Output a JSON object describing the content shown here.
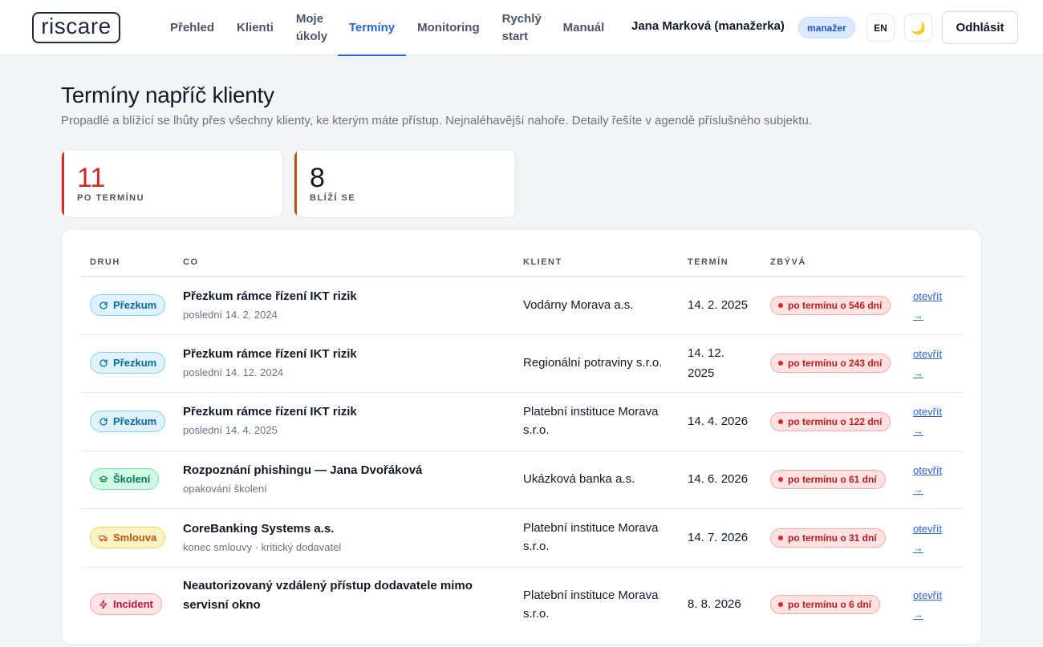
{
  "app": {
    "logo_text": "riscare"
  },
  "nav": {
    "items": [
      {
        "label": "Přehled"
      },
      {
        "label": "Klienti"
      },
      {
        "label": "Moje úkoly"
      },
      {
        "label": "Termíny"
      },
      {
        "label": "Monitoring"
      },
      {
        "label": "Rychlý start"
      },
      {
        "label": "Manuál"
      }
    ],
    "active": "Termíny"
  },
  "user": {
    "name": "Jana Marková (manažerka)",
    "role": "manažer",
    "lang_label": "EN",
    "theme_icon": "🌙",
    "logout_label": "Odhlásit"
  },
  "page": {
    "title": "Termíny napříč klienty",
    "subtitle": "Propadlé a blížící se lhůty přes všechny klienty, ke kterým máte přístup. Nejnaléhavější nahoře. Detaily řešíte v agendě příslušného subjektu."
  },
  "stats": [
    {
      "value": "11",
      "label": "PO TERMÍNU",
      "color": "#dc2626"
    },
    {
      "value": "8",
      "label": "BLÍŽÍ SE",
      "color": "#b45309"
    }
  ],
  "table": {
    "columns": [
      "DRUH",
      "CO",
      "KLIENT",
      "TERMÍN",
      "ZBÝVÁ"
    ],
    "rows": [
      {
        "type": "Přezkum",
        "kind": "review",
        "title": "Přezkum rámce řízení IKT rizik",
        "sub": "poslední 14. 2. 2024",
        "client": "Vodárny Morava a.s.",
        "date": "14. 2. 2025",
        "remaining": "po termínu o 546 dní",
        "link": "otevřít →"
      },
      {
        "type": "Přezkum",
        "kind": "review",
        "title": "Přezkum rámce řízení IKT rizik",
        "sub": "poslední 14. 12. 2024",
        "client": "Regionální potraviny s.r.o.",
        "date": "14. 12. 2025",
        "remaining": "po termínu o 243 dní",
        "link": "otevřít →"
      },
      {
        "type": "Přezkum",
        "kind": "review",
        "title": "Přezkum rámce řízení IKT rizik",
        "sub": "poslední 14. 4. 2025",
        "client": "Platební instituce Morava s.r.o.",
        "date": "14. 4. 2026",
        "remaining": "po termínu o 122 dní",
        "link": "otevřít →"
      },
      {
        "type": "Školení",
        "kind": "training",
        "title": "Rozpoznání phishingu — Jana Dvořáková",
        "sub": "opakování školení",
        "client": "Ukázková banka a.s.",
        "date": "14. 6. 2026",
        "remaining": "po termínu o 61 dní",
        "link": "otevřít →"
      },
      {
        "type": "Smlouva",
        "kind": "contract",
        "title": "CoreBanking Systems a.s.",
        "sub": "konec smlouvy · kritický dodavatel",
        "client": "Platební instituce Morava s.r.o.",
        "date": "14. 7. 2026",
        "remaining": "po termínu o 31 dní",
        "link": "otevřít →"
      },
      {
        "type": "Incident",
        "kind": "incident",
        "title": "Neautorizovaný vzdálený přístup dodavatele mimo servisní okno",
        "sub": "",
        "client": "Platební instituce Morava s.r.o.",
        "date": "8. 8. 2026",
        "remaining": "po termínu o 6 dní",
        "link": "otevřít →"
      }
    ]
  },
  "colors": {
    "accent": "#2563eb",
    "review": "#0369a1",
    "training": "#047857",
    "contract": "#b45309",
    "incident": "#be123c",
    "overdue": "#b91c1c"
  }
}
